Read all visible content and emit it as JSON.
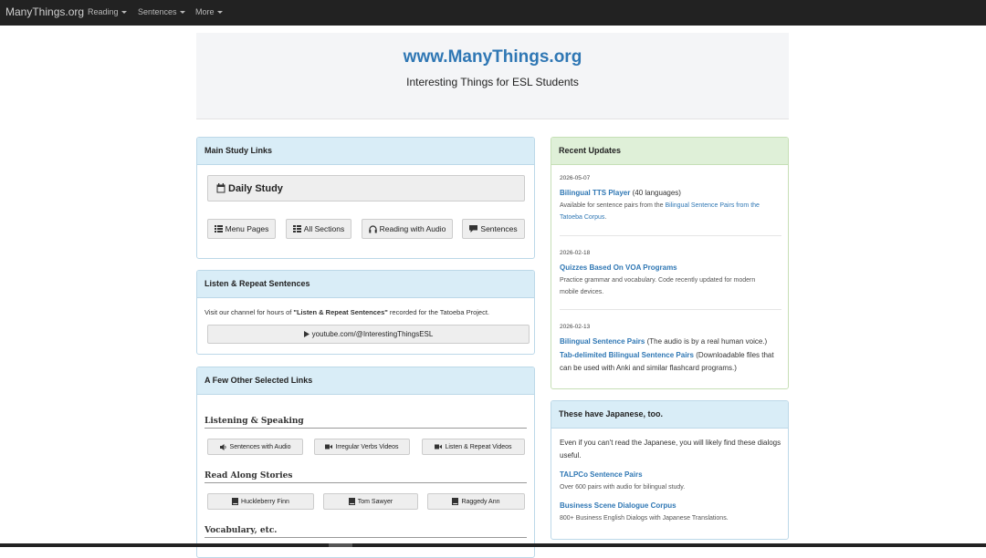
{
  "navbar": {
    "brand": "ManyThings.org",
    "items": [
      "Reading",
      "Sentences",
      "More"
    ]
  },
  "jumbotron": {
    "title": "www.ManyThings.org",
    "subtitle": "Interesting Things for ESL Students"
  },
  "main_links": {
    "heading": "Main Study Links",
    "daily_study": "Daily Study",
    "buttons": [
      "Menu Pages",
      "All Sections",
      "Reading with Audio",
      "Sentences"
    ]
  },
  "listen_repeat": {
    "heading": "Listen & Repeat Sentences",
    "text_before": "Visit our channel for hours of ",
    "text_bold": "\"Listen & Repeat Sentences\"",
    "text_after": " recorded for the Tatoeba Project.",
    "youtube_label": "youtube.com/@InterestingThingsESL"
  },
  "other_links": {
    "heading": "A Few Other Selected Links",
    "sections": [
      {
        "title": "Listening & Speaking",
        "buttons": [
          "Sentences with Audio",
          "Irregular Verbs Videos",
          "Listen & Repeat Videos"
        ]
      },
      {
        "title": "Read Along Stories",
        "buttons": [
          "Huckleberry Finn",
          "Tom Sawyer",
          "Raggedy Ann"
        ]
      },
      {
        "title": "Vocabulary, etc.",
        "buttons": []
      }
    ]
  },
  "recent_updates": {
    "heading": "Recent Updates",
    "entries": [
      {
        "date": "2026-05-07",
        "link": "Bilingual TTS Player",
        "link_suffix": " (40 languages)",
        "desc_before": "Available for sentence pairs from the ",
        "desc_link": "Bilingual Sentence Pairs from the Tatoeba Corpus",
        "desc_after": "."
      },
      {
        "date": "2026-02-18",
        "link": "Quizzes Based On VOA Programs",
        "desc": "Practice grammar and vocabulary. Code recently updated for modern mobile devices."
      },
      {
        "date": "2026-02-13",
        "link": "Bilingual Sentence Pairs",
        "link_suffix": " (The audio is by a real human voice.)",
        "link2": "Tab-delimited Bilingual Sentence Pairs",
        "link2_suffix": " (Downloadable files that can be used with Anki and similar flashcard programs.)"
      }
    ]
  },
  "japanese": {
    "heading": "These have Japanese, too.",
    "intro": "Even if you can't read the Japanese, you will likely find these dialogs useful.",
    "items": [
      {
        "link": "TALPCo Sentence Pairs",
        "desc": "Over 600 pairs with audio for bilingual study."
      },
      {
        "link": "Business Scene Dialogue Corpus",
        "desc": "800+ Business English Dialogs with Japanese Translations."
      }
    ]
  }
}
